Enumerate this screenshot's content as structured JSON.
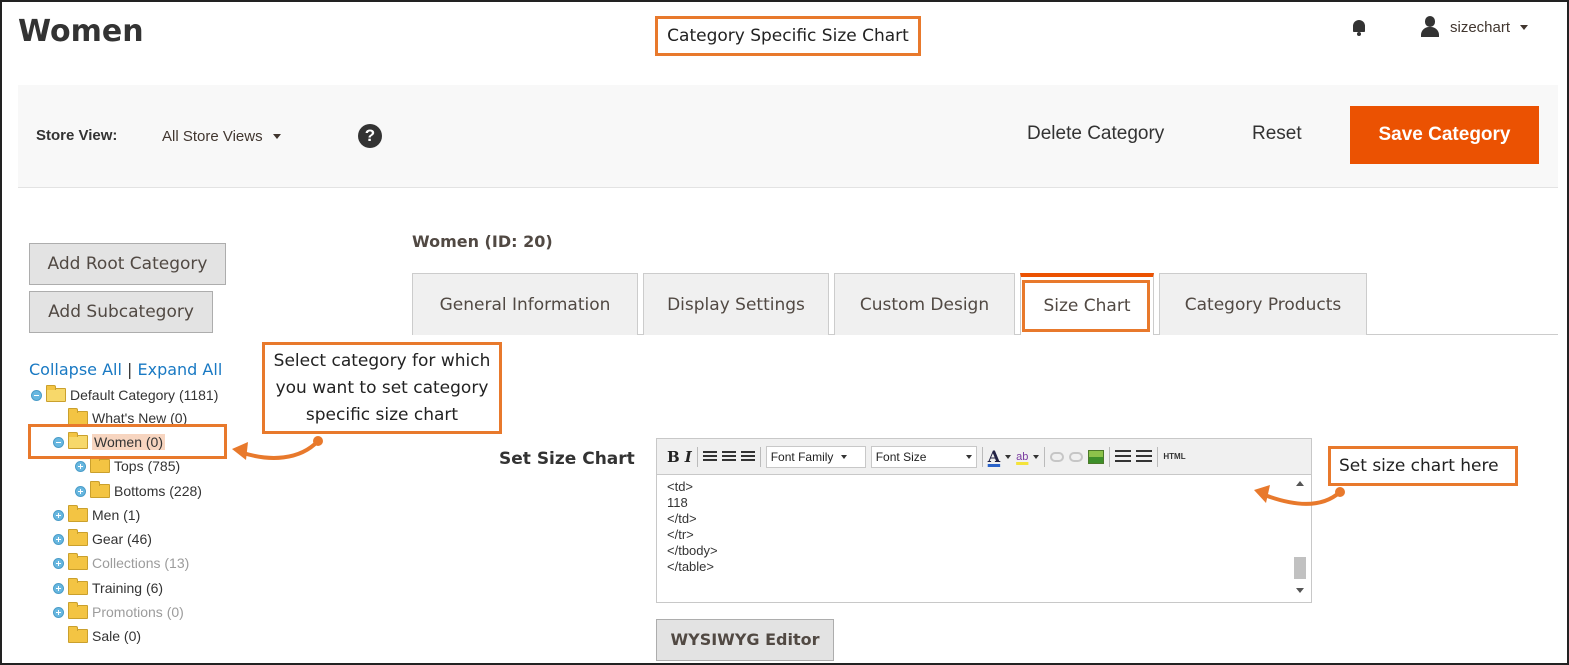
{
  "header": {
    "page_title": "Women",
    "callout": "Category Specific Size Chart",
    "user_name": "sizechart"
  },
  "actionbar": {
    "store_view_label": "Store View:",
    "store_view_value": "All Store Views",
    "help_glyph": "?",
    "delete_label": "Delete Category",
    "reset_label": "Reset",
    "save_label": "Save Category",
    "save_color": "#eb5202"
  },
  "sidebar": {
    "add_root_label": "Add Root Category",
    "add_sub_label": "Add Subcategory",
    "collapse_all": "Collapse All",
    "separator": "|",
    "expand_all": "Expand All",
    "tree": [
      {
        "label": "Default Category (1181)",
        "icon": "folder-open-icon"
      },
      {
        "label": "What's New (0)",
        "icon": "folder-icon"
      },
      {
        "label": "Women (0)",
        "icon": "folder-open-icon",
        "selected": true
      },
      {
        "label": "Tops (785)",
        "icon": "folder-icon"
      },
      {
        "label": "Bottoms (228)",
        "icon": "folder-icon"
      },
      {
        "label": "Men (1)",
        "icon": "folder-icon"
      },
      {
        "label": "Gear (46)",
        "icon": "folder-icon"
      },
      {
        "label": "Collections (13)",
        "icon": "folder-icon",
        "disabled": true
      },
      {
        "label": "Training (6)",
        "icon": "folder-icon"
      },
      {
        "label": "Promotions (0)",
        "icon": "folder-icon",
        "disabled": true
      },
      {
        "label": "Sale (0)",
        "icon": "folder-icon"
      }
    ],
    "callout": "Select category for which you want to set category specific size chart"
  },
  "main": {
    "category_id": "Women (ID: 20)",
    "tabs": [
      {
        "label": "General Information"
      },
      {
        "label": "Display Settings"
      },
      {
        "label": "Custom Design"
      },
      {
        "label": "Size Chart",
        "active": true
      },
      {
        "label": "Category Products"
      }
    ],
    "set_size_chart_label": "Set Size Chart",
    "editor": {
      "toolbar": {
        "bold": "B",
        "italic": "I",
        "font_family": "Font Family",
        "font_size": "Font Size",
        "font_color_glyph": "A",
        "highlight_glyph": "ab",
        "html": "HTML"
      },
      "content": "<td>\n118\n</td>\n</tr>\n</tbody>\n</table>"
    },
    "editor_callout": "Set size chart here",
    "wysiwyg_label": "WYSIWYG Editor"
  },
  "colors": {
    "callout_border": "#e8792c",
    "link": "#1979c3"
  }
}
